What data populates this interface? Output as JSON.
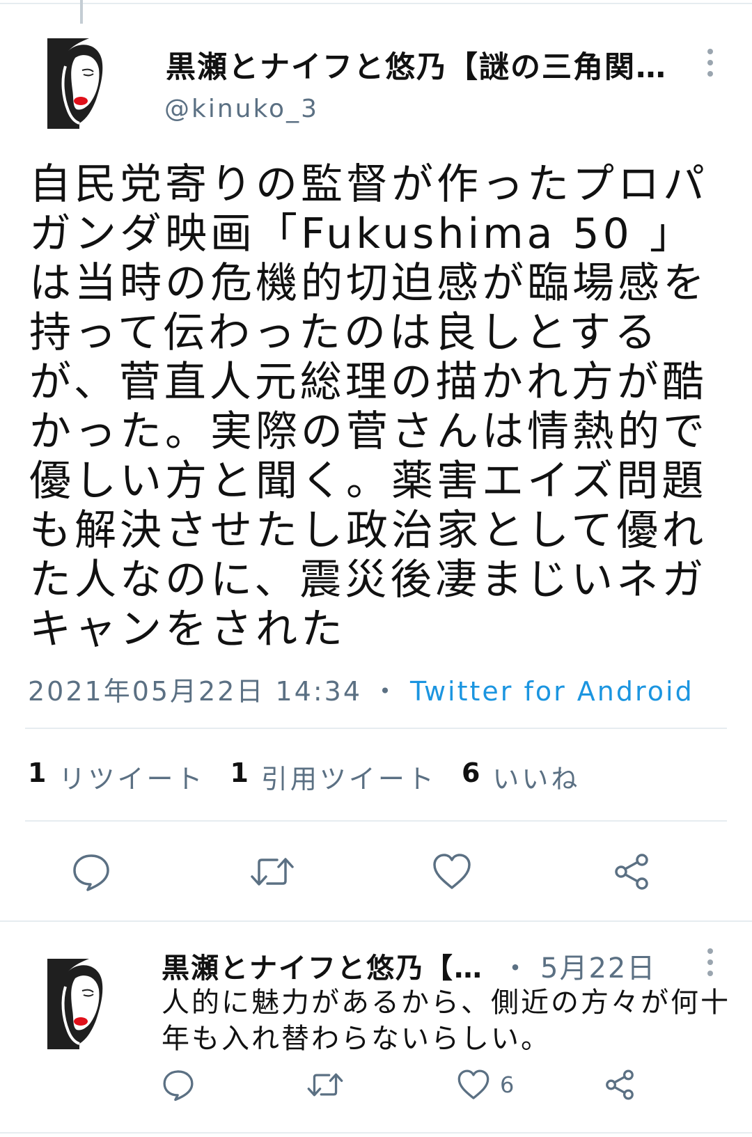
{
  "main_tweet": {
    "author_name": "黒瀬とナイフと悠乃【謎の三角関…",
    "author_handle": "@kinuko_3",
    "body": "自民党寄りの監督が作ったプロパガンダ映画「Fukushima 50 」は当時の危機的切迫感が臨場感を持って伝わったのは良しとするが、菅直人元総理の描かれ方が酷かった。実際の菅さんは情熱的で優しい方と聞く。薬害エイズ問題も解決させたし政治家として優れた人なのに、震災後凄まじいネガキャンをされた",
    "date": "2021年05月22日 14:34",
    "separator": "・",
    "source": "Twitter for Android",
    "stats": {
      "retweets_count": "1",
      "retweets_label": "リツイート",
      "quotes_count": "1",
      "quotes_label": "引用ツイート",
      "likes_count": "6",
      "likes_label": "いいね"
    },
    "actions": [
      "reply-icon",
      "retweet-icon",
      "like-icon",
      "share-icon"
    ]
  },
  "reply_tweet": {
    "author_name": "黒瀬とナイフと悠乃【…",
    "separator": "・",
    "date": "5月22日",
    "body": "人的に魅力があるから、側近の方々が何十年も入れ替わらないらしい。",
    "like_count": "6",
    "actions": [
      "reply-icon",
      "retweet-icon",
      "like-icon",
      "share-icon"
    ]
  },
  "colors": {
    "text": "#111111",
    "secondary": "#5b7083",
    "link": "#1b95e0",
    "divider": "#e6ecf0",
    "lips": "#e0101a"
  }
}
